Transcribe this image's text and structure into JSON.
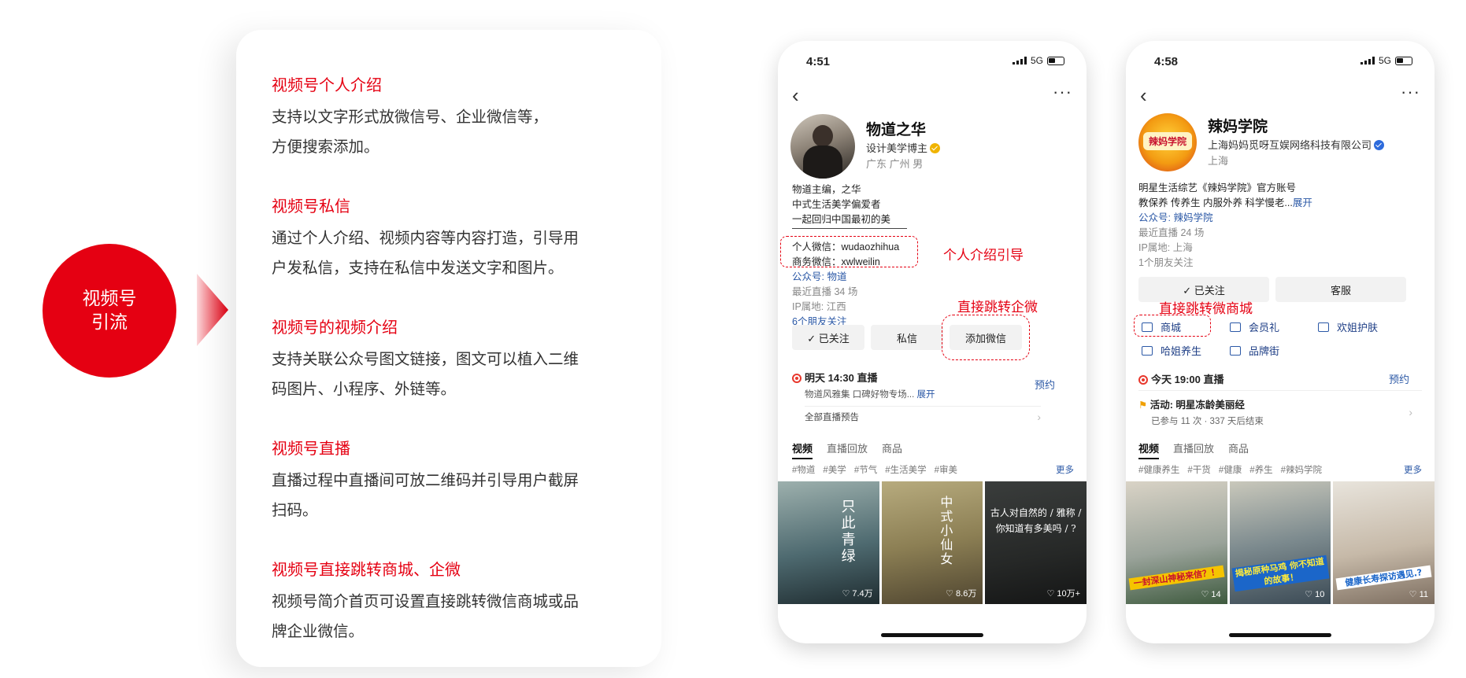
{
  "left": {
    "circle_line1": "视频号",
    "circle_line2": "引流"
  },
  "sections": [
    {
      "title": "视频号个人介绍",
      "lines": [
        "支持以文字形式放微信号、企业微信等，",
        "方便搜索添加。"
      ]
    },
    {
      "title": "视频号私信",
      "lines": [
        "通过个人介绍、视频内容等内容打造，引导用",
        "户发私信，支持在私信中发送文字和图片。"
      ]
    },
    {
      "title": "视频号的视频介绍",
      "lines": [
        "支持关联公众号图文链接，图文可以植入二维",
        "码图片、小程序、外链等。"
      ]
    },
    {
      "title": "视频号直播",
      "lines": [
        "直播过程中直播间可放二维码并引导用户截屏",
        "扫码。"
      ]
    },
    {
      "title": "视频号直接跳转商城、企微",
      "lines": [
        "视频号简介首页可设置直接跳转微信商城或品",
        "牌企业微信。"
      ]
    }
  ],
  "phone1": {
    "time": "4:51",
    "network": "5G",
    "name": "物道之华",
    "role": "设计美学博主",
    "location": "广东 广州 男",
    "bio": [
      "物道主编，之华",
      "中式生活美学偏爱者",
      "一起回归中国最初的美"
    ],
    "wechat_personal": "个人微信：wudaozhihua",
    "wechat_business": "商务微信：xwlweilin",
    "official_account": "公众号: 物道",
    "recent_live": "最近直播 34 场",
    "ip": "IP属地: 江西",
    "friends": "6个朋友关注",
    "btn_followed": "✓ 已关注",
    "btn_message": "私信",
    "btn_add_wechat": "添加微信",
    "live_title": "明天 14:30 直播",
    "live_desc": "物道风雅集 口碑好物专场...",
    "live_expand": "展开",
    "live_reserve": "预约",
    "live_all": "全部直播预告",
    "tabs": [
      "视频",
      "直播回放",
      "商品"
    ],
    "tags": [
      "#物道",
      "#美学",
      "#节气",
      "#生活美学",
      "#审美"
    ],
    "more": "更多",
    "thumbs": [
      {
        "text": "只此青绿",
        "likes": "♡ 7.4万"
      },
      {
        "text": "中式小仙女",
        "likes": "♡ 8.6万"
      },
      {
        "text": "古人对自然的 / 雅称 / 你知道有多美吗 / ?",
        "likes": "♡ 10万+"
      }
    ],
    "annot_intro": "个人介绍引导",
    "annot_qiwei": "直接跳转企微"
  },
  "phone2": {
    "time": "4:58",
    "network": "5G",
    "name": "辣妈学院",
    "company": "上海妈妈觅呀互娱网络科技有限公司",
    "location": "上海",
    "logo_text": "辣妈学院",
    "bio1": "明星生活综艺《辣妈学院》官方账号",
    "bio2": "教保养 传养生 内服外养 科学慢老...",
    "bio_expand": "展开",
    "official_account": "公众号: 辣妈学院",
    "recent_live": "最近直播 24 场",
    "ip": "IP属地: 上海",
    "friends": "1个朋友关注",
    "btn_followed": "✓ 已关注",
    "btn_service": "客服",
    "shop_items": [
      "商城",
      "会员礼",
      "欢姐护肤",
      "哈姐养生",
      "品牌街"
    ],
    "live_title": "今天 19:00 直播",
    "live_reserve": "预约",
    "activity_title": "活动: 明星冻龄美丽经",
    "activity_meta": "已参与 11 次 · 337 天后结束",
    "tabs": [
      "视频",
      "直播回放",
      "商品"
    ],
    "tags": [
      "#健康养生",
      "#干货",
      "#健康",
      "#养生",
      "#辣妈学院"
    ],
    "more": "更多",
    "thumbs": [
      {
        "text": "一封深山神秘来信？！",
        "likes": "♡ 14"
      },
      {
        "text": "揭秘原种马鸡 你不知道的故事！",
        "likes": "♡ 10"
      },
      {
        "text": "健康长寿探访遇见.?",
        "likes": "♡ 11"
      }
    ],
    "annot_mall": "直接跳转微商城"
  }
}
